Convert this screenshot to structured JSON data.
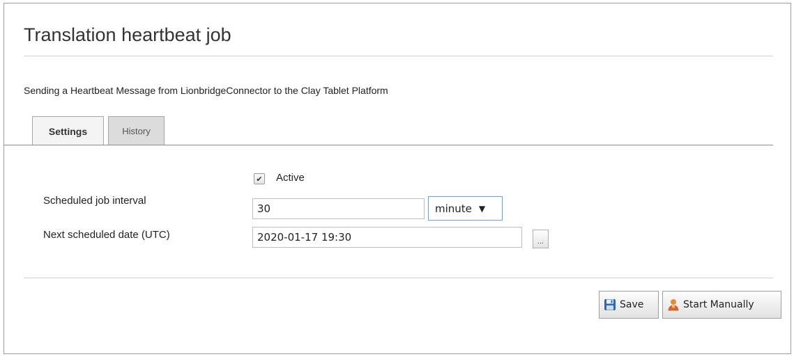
{
  "page": {
    "title": "Translation heartbeat job",
    "description": "Sending a Heartbeat Message from LionbridgeConnector to the Clay Tablet Platform"
  },
  "tabs": [
    {
      "label": "Settings",
      "active": true
    },
    {
      "label": "History",
      "active": false
    }
  ],
  "settings": {
    "active_label": "Active",
    "active_checked": true,
    "interval_label": "Scheduled job interval",
    "interval_value": "30",
    "interval_unit": "minute",
    "next_date_label": "Next scheduled date (UTC)",
    "next_date_value": "2020-01-17 19:30",
    "picker_label": "..."
  },
  "actions": {
    "save_label": "Save",
    "start_label": "Start Manually"
  },
  "icons": {
    "checkbox": "checkmark-icon",
    "dropdown": "triangle-down-icon",
    "save": "floppy-disk-icon",
    "start": "user-icon"
  },
  "colors": {
    "save_icon": "#2f67b1",
    "start_icon": "#d9622b",
    "select_border": "#7a9cc4"
  }
}
